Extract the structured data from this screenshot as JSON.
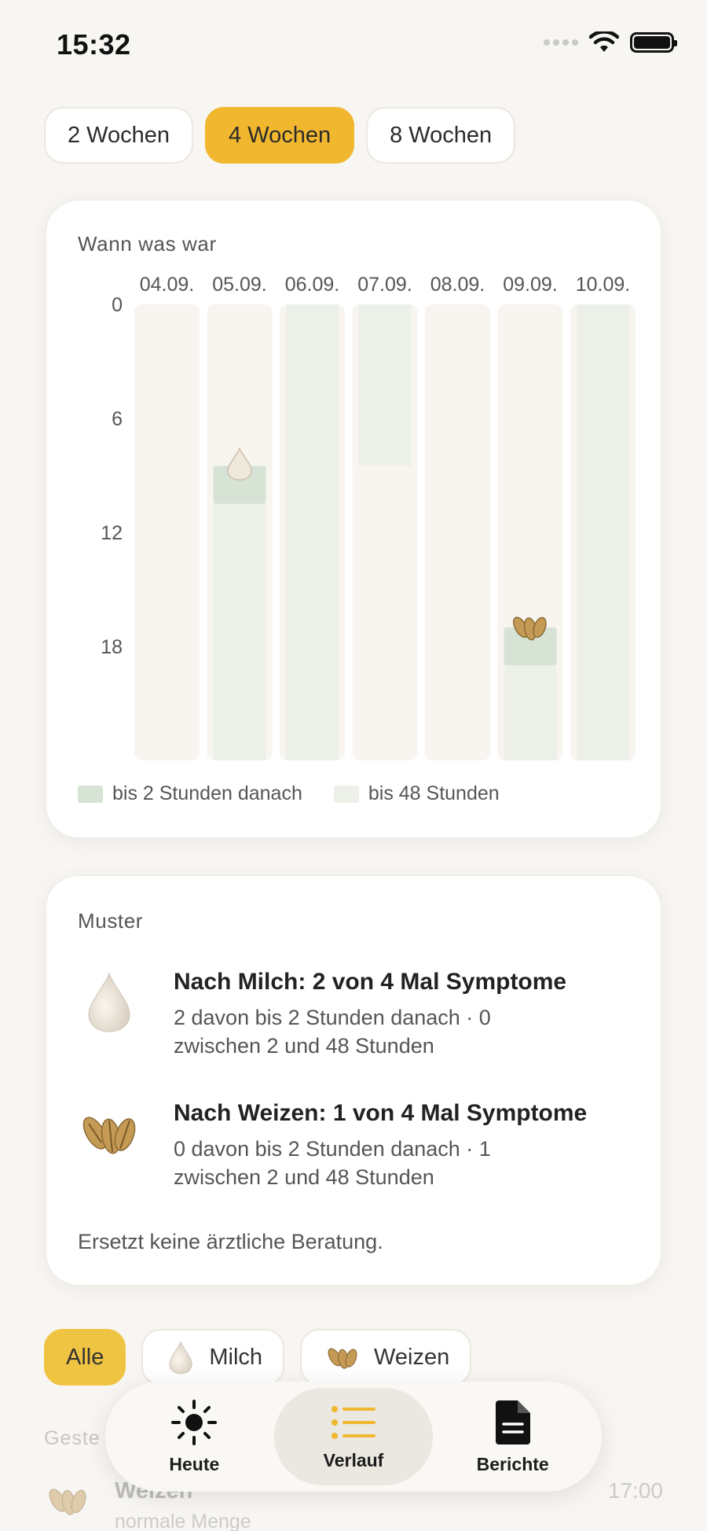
{
  "status": {
    "time": "15:32"
  },
  "range": {
    "options": [
      "2 Wochen",
      "4 Wochen",
      "8 Wochen"
    ],
    "selected": "4 Wochen"
  },
  "chart_card": {
    "title": "Wann was war",
    "legend": {
      "near": "bis 2 Stunden danach",
      "far": "bis 48 Stunden"
    }
  },
  "chart_data": {
    "type": "timeline",
    "title": "Wann was war",
    "categories": [
      "04.09.",
      "05.09.",
      "06.09.",
      "07.09.",
      "08.09.",
      "09.09.",
      "10.09."
    ],
    "y_ticks": [
      0,
      6,
      12,
      18
    ],
    "ylim": [
      0,
      24
    ],
    "y_axis_inverted": true,
    "events": [
      {
        "day": "05.09.",
        "hour": 8.5,
        "food": "Milch",
        "window_2h": [
          8.5,
          10.5
        ],
        "window_48h_shaded_from": 10.5
      },
      {
        "day": "09.09.",
        "hour": 17,
        "food": "Weizen",
        "window_2h": [
          17,
          19
        ],
        "window_48h_shaded_from": 19
      }
    ],
    "shaded_48h": [
      {
        "day": "06.09.",
        "from": 0,
        "to": 24
      },
      {
        "day": "07.09.",
        "from": 0,
        "to": 8.5
      },
      {
        "day": "10.09.",
        "from": 0,
        "to": 24
      }
    ],
    "colors": {
      "bar_bg": "#f8f5f0",
      "near": "#d7e3d5",
      "far": "#edf0e8"
    },
    "legend": [
      "bis 2 Stunden danach",
      "bis 48 Stunden"
    ],
    "legend_position": "bottom-left"
  },
  "patterns": {
    "title": "Muster",
    "items": [
      {
        "icon": "milk-drop-icon",
        "head": "Nach Milch: 2 von 4 Mal Symptome",
        "sub": "2 davon bis 2 Stunden danach · 0 zwischen 2 und 48 Stunden"
      },
      {
        "icon": "wheat-grain-icon",
        "head": "Nach Weizen: 1 von 4 Mal Symptome",
        "sub": "0 davon bis 2 Stunden danach · 1 zwischen 2 und 48 Stunden"
      }
    ],
    "disclaimer": "Ersetzt keine ärztliche Beratung."
  },
  "filters": {
    "all": "Alle",
    "milk": "Milch",
    "wheat": "Weizen",
    "selected": "Alle"
  },
  "list": {
    "section": "Geste",
    "rows": [
      {
        "name": "Weizen",
        "detail": "normale Menge",
        "time": "17:00"
      }
    ]
  },
  "tabbar": {
    "today": "Heute",
    "history": "Verlauf",
    "reports": "Berichte",
    "selected": "Verlauf"
  }
}
